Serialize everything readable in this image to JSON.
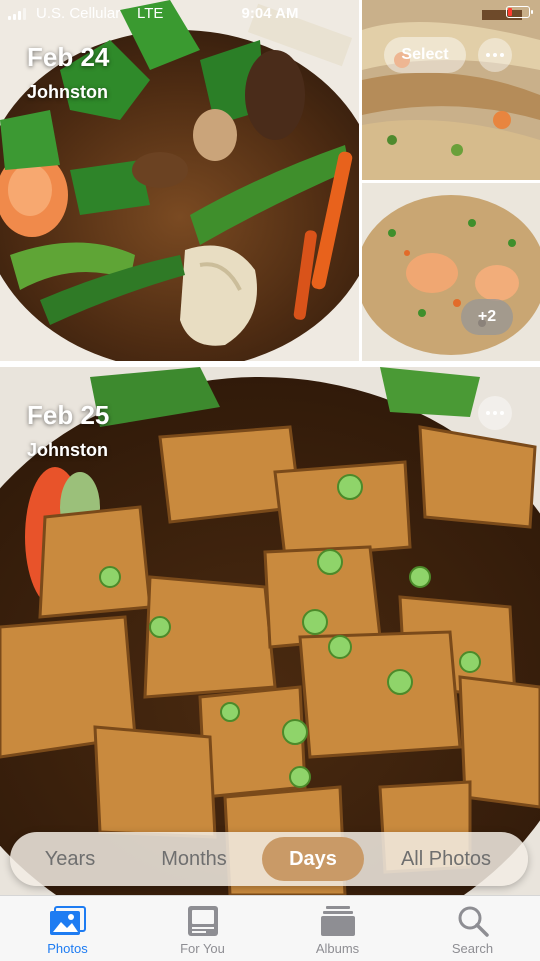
{
  "status_bar": {
    "carrier": "U.S. Cellular",
    "network": "LTE",
    "time": "9:04 AM",
    "battery_level": 0.2,
    "battery_color": "#ff3b30"
  },
  "moments": [
    {
      "date": "Feb 24",
      "location": "Johnston",
      "select_label": "Select",
      "more_icon": "ellipsis-icon",
      "extra_count_label": "+2"
    },
    {
      "date": "Feb 25",
      "location": "Johnston",
      "more_icon": "ellipsis-icon"
    }
  ],
  "view_switcher": {
    "options": [
      "Years",
      "Months",
      "Days",
      "All Photos"
    ],
    "selected": "Days",
    "accent_color": "#c99a67"
  },
  "tab_bar": {
    "tabs": [
      {
        "label": "Photos",
        "icon": "photos-icon"
      },
      {
        "label": "For You",
        "icon": "for-you-icon"
      },
      {
        "label": "Albums",
        "icon": "albums-icon"
      },
      {
        "label": "Search",
        "icon": "search-icon"
      }
    ],
    "selected": "Photos",
    "accent_color": "#1e7cf2"
  }
}
